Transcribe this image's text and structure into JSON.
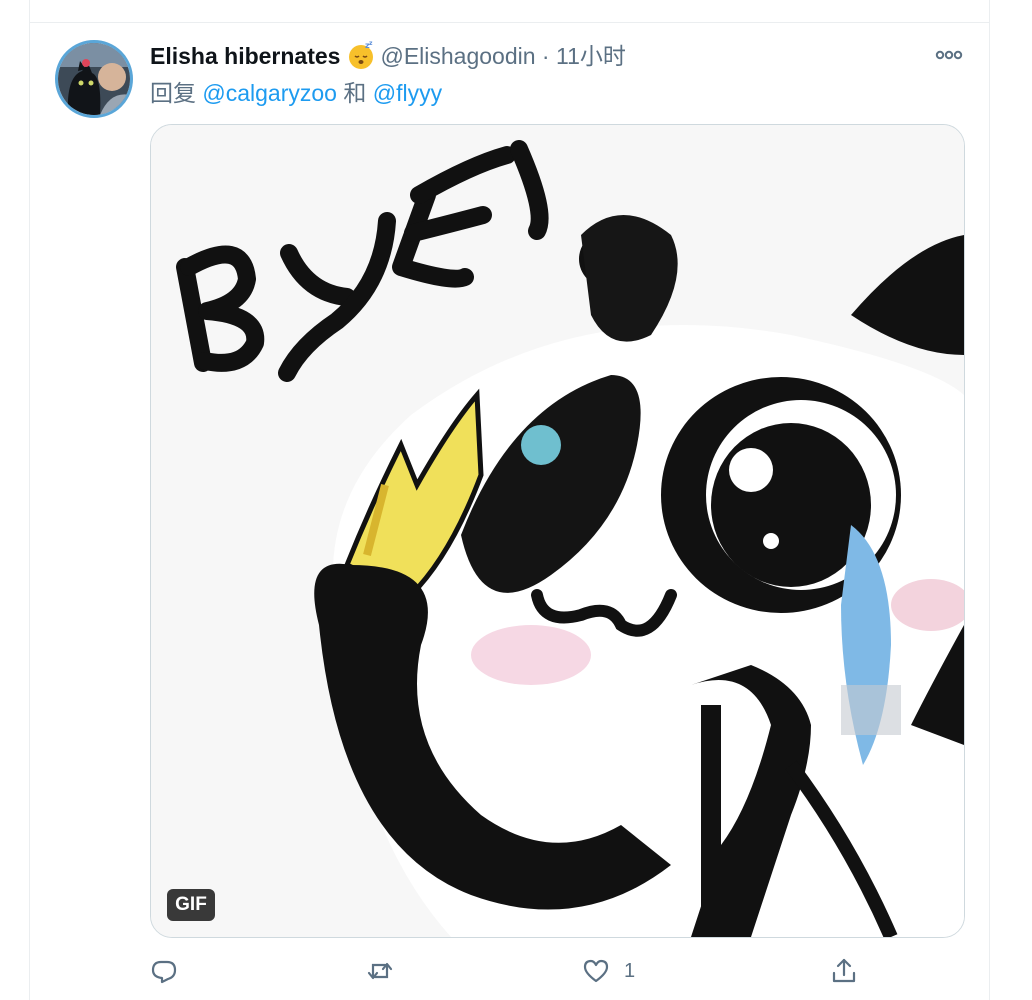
{
  "tweet": {
    "display_name": "Elisha hibernates",
    "handle": "@Elishagoodin",
    "separator": "·",
    "time": "11小时",
    "reply_prefix": "回复",
    "mentions": [
      "@calgaryzoo",
      "@flyyy"
    ],
    "mention_joiner": "和",
    "media": {
      "badge": "GIF",
      "caption_in_image": "BYE"
    },
    "actions": {
      "reply_icon": "reply-icon",
      "retweet_icon": "retweet-icon",
      "like_icon": "heart-icon",
      "like_count": "1",
      "share_icon": "share-icon"
    }
  },
  "colors": {
    "link": "#1d9bf0",
    "secondary_text": "#5b7083",
    "border": "#ebeef0"
  }
}
